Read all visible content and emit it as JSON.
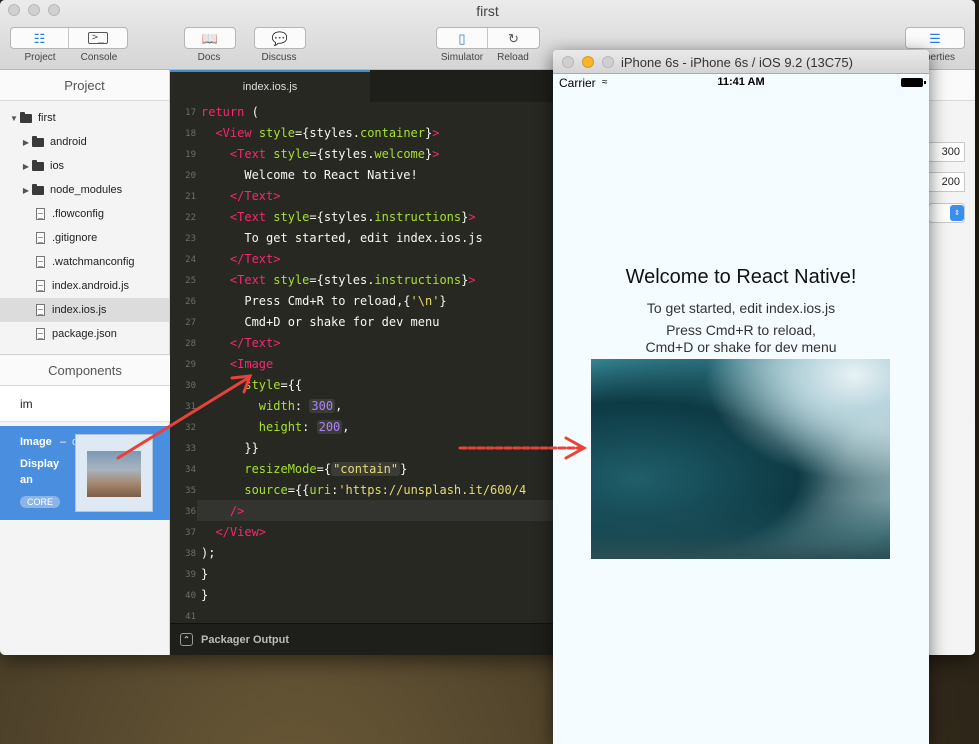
{
  "app": {
    "title": "first",
    "toolbar": {
      "project": "Project",
      "console": "Console",
      "docs": "Docs",
      "discuss": "Discuss",
      "simulator": "Simulator",
      "reload": "Reload",
      "properties": "perties"
    }
  },
  "sidebar": {
    "header": "Project",
    "tree": [
      {
        "label": "first",
        "type": "folder",
        "expanded": true,
        "indent": 0
      },
      {
        "label": "android",
        "type": "folder",
        "expanded": false,
        "indent": 1
      },
      {
        "label": "ios",
        "type": "folder",
        "expanded": false,
        "indent": 1
      },
      {
        "label": "node_modules",
        "type": "folder",
        "expanded": false,
        "indent": 1
      },
      {
        "label": ".flowconfig",
        "type": "file",
        "indent": 1
      },
      {
        "label": ".gitignore",
        "type": "file",
        "indent": 1
      },
      {
        "label": ".watchmanconfig",
        "type": "file",
        "indent": 1
      },
      {
        "label": "index.android.js",
        "type": "file",
        "indent": 1
      },
      {
        "label": "index.ios.js",
        "type": "file",
        "indent": 1,
        "selected": true
      },
      {
        "label": "package.json",
        "type": "file",
        "indent": 1
      }
    ],
    "components_header": "Components",
    "search_value": "im",
    "component": {
      "name": "Image",
      "dash": "–",
      "desc_tail": "deco",
      "desc": "Display an",
      "badge": "CORE"
    }
  },
  "editor": {
    "tab": "index.ios.js",
    "line_numbers": [
      "17",
      "18",
      "19",
      "20",
      "21",
      "22",
      "23",
      "24",
      "25",
      "26",
      "27",
      "28",
      "29",
      "30",
      "31",
      "32",
      "33",
      "34",
      "35",
      "36",
      "37",
      "38",
      "39",
      "40",
      "41"
    ],
    "packager": "Packager Output"
  },
  "properties": {
    "width": "300",
    "height": "200"
  },
  "simulator": {
    "title": "iPhone 6s - iPhone 6s / iOS 9.2 (13C75)",
    "carrier": "Carrier",
    "time": "11:41 AM",
    "welcome": "Welcome to React Native!",
    "instructions_1": "To get started, edit index.ios.js",
    "instructions_2": "Press Cmd+R to reload,",
    "instructions_3": "Cmd+D or shake for dev menu"
  },
  "colors": {
    "editor_bg": "#272822",
    "keyword": "#f92672",
    "attribute": "#a6e22e",
    "string": "#e6db74",
    "number": "#ae81ff",
    "component_card": "#4a8fdf",
    "arrow": "#e8423a"
  }
}
